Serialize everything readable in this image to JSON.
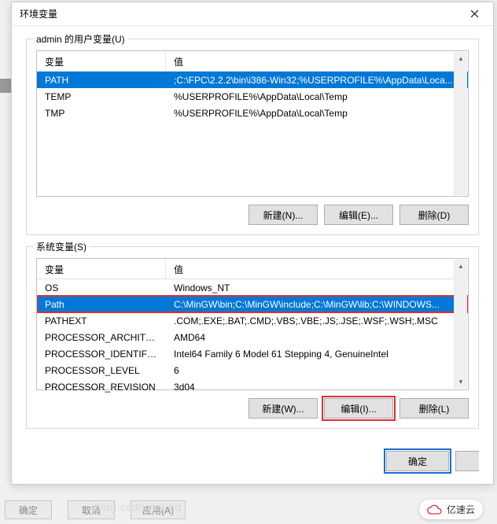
{
  "window": {
    "title": "环境变量"
  },
  "user_vars": {
    "group_label": "admin 的用户变量(U)",
    "col_var": "变量",
    "col_val": "值",
    "rows": [
      {
        "var": "PATH",
        "val": ";C:\\FPC\\2.2.2\\bin\\i386-Win32;%USERPROFILE%\\AppData\\Loca..."
      },
      {
        "var": "TEMP",
        "val": "%USERPROFILE%\\AppData\\Local\\Temp"
      },
      {
        "var": "TMP",
        "val": "%USERPROFILE%\\AppData\\Local\\Temp"
      }
    ],
    "btn_new": "新建(N)...",
    "btn_edit": "编辑(E)...",
    "btn_del": "删除(D)"
  },
  "sys_vars": {
    "group_label": "系统变量(S)",
    "col_var": "变量",
    "col_val": "值",
    "rows": [
      {
        "var": "OS",
        "val": "Windows_NT"
      },
      {
        "var": "Path",
        "val": "C:\\MinGW\\bin;C:\\MinGW\\include;C:\\MinGW\\lib;C:\\WINDOWS..."
      },
      {
        "var": "PATHEXT",
        "val": ".COM;.EXE;.BAT;.CMD;.VBS;.VBE;.JS;.JSE;.WSF;.WSH;.MSC"
      },
      {
        "var": "PROCESSOR_ARCHITECT...",
        "val": "AMD64"
      },
      {
        "var": "PROCESSOR_IDENTIFIER",
        "val": "Intel64 Family 6 Model 61 Stepping 4, GenuineIntel"
      },
      {
        "var": "PROCESSOR_LEVEL",
        "val": "6"
      },
      {
        "var": "PROCESSOR_REVISION",
        "val": "3d04"
      }
    ],
    "btn_new": "新建(W)...",
    "btn_edit": "编辑(I)...",
    "btn_del": "删除(L)"
  },
  "footer": {
    "ok": "确定",
    "cancel_partial": ""
  },
  "background": {
    "ok": "确定",
    "cancel": "取消",
    "apply": "应用(A)"
  },
  "watermark": {
    "text": "亿速云",
    "url": "blog.csdn.net/qq"
  }
}
